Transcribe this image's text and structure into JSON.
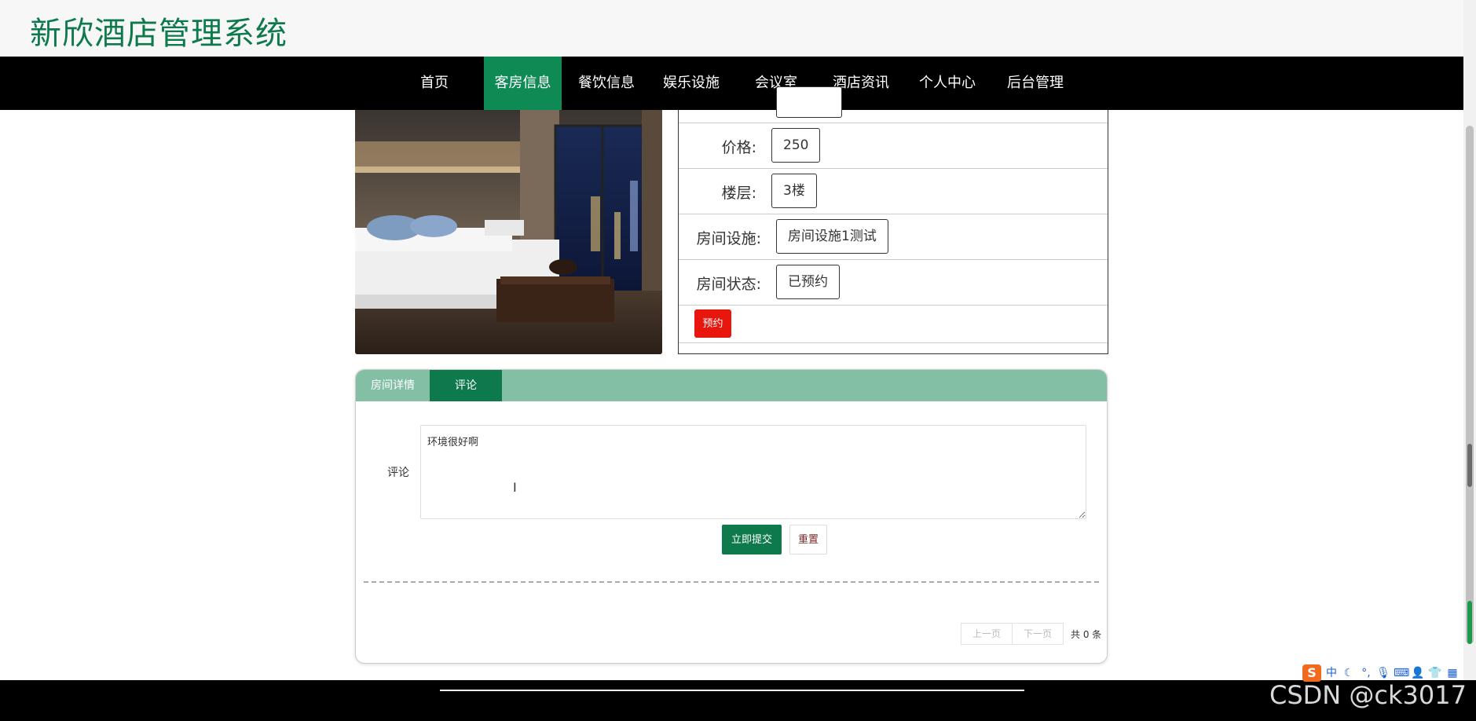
{
  "header": {
    "title": "新欣酒店管理系统"
  },
  "nav": {
    "items": [
      {
        "label": "首页"
      },
      {
        "label": "客房信息",
        "active": true
      },
      {
        "label": "餐饮信息"
      },
      {
        "label": "娱乐设施"
      },
      {
        "label": "会议室"
      },
      {
        "label": "酒店资讯"
      },
      {
        "label": "个人中心"
      },
      {
        "label": "后台管理"
      }
    ]
  },
  "room": {
    "price_label": "价格:",
    "price_value": "250",
    "floor_label": "楼层:",
    "floor_value": "3楼",
    "facilities_label": "房间设施:",
    "facilities_value": "房间设施1测试",
    "status_label": "房间状态:",
    "status_value": "已预约",
    "reserve_label": "预约"
  },
  "tabs": {
    "details_label": "房间详情",
    "comment_label": "评论"
  },
  "comment_form": {
    "field_label": "评论",
    "value": "环境很好啊",
    "submit_label": "立即提交",
    "reset_label": "重置"
  },
  "pagination": {
    "prev_label": "上一页",
    "next_label": "下一页",
    "total_label": "共 0 条"
  },
  "watermark": "CSDN @ck3017",
  "ime": {
    "logo": "S",
    "mode_label": "中"
  },
  "colors": {
    "brand_green": "#0e7a4c",
    "nav_active": "#0e8a55",
    "tabbar": "#83bfa4",
    "reserve_red": "#e8160c"
  }
}
